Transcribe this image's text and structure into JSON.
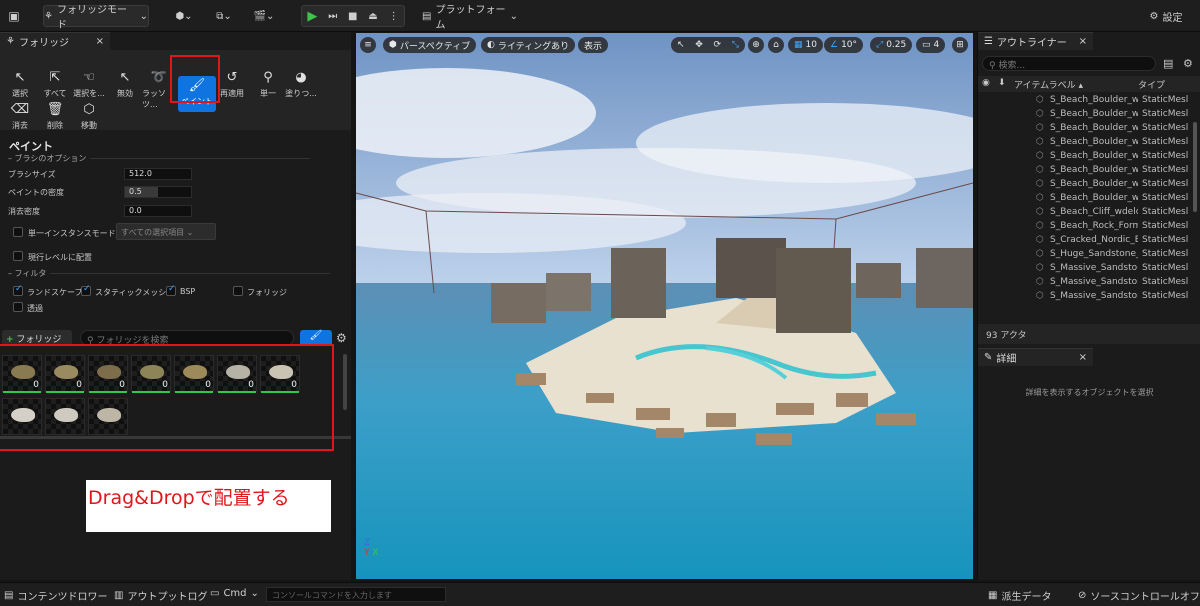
{
  "toolbar": {
    "mode_label": "フォリッジモード",
    "platform_label": "プラットフォーム",
    "settings_label": "設定"
  },
  "foliage_tab": {
    "title": "フォリッジ"
  },
  "tools": [
    {
      "label": "選択",
      "icon": "cursor-icon"
    },
    {
      "label": "すべて",
      "icon": "select-all-icon"
    },
    {
      "label": "選択を...",
      "icon": "hand-icon"
    },
    {
      "label": "無効",
      "icon": "invalid-icon"
    },
    {
      "label": "ラッソツ...",
      "icon": "lasso-icon"
    },
    {
      "label": "ペイント",
      "icon": "paintbrush-icon"
    },
    {
      "label": "再適用",
      "icon": "reapply-icon"
    },
    {
      "label": "単一",
      "icon": "single-icon"
    },
    {
      "label": "塗りつ...",
      "icon": "fill-icon"
    },
    {
      "label": "消去",
      "icon": "erase-icon"
    },
    {
      "label": "削除",
      "icon": "trash-icon"
    },
    {
      "label": "移動",
      "icon": "move-icon"
    }
  ],
  "paint": {
    "title": "ペイント",
    "brush_section": "ブラシのオプション",
    "brush_size_label": "ブラシサイズ",
    "brush_size_value": "512.0",
    "paint_density_label": "ペイントの密度",
    "paint_density_value": "0.5",
    "erase_density_label": "消去密度",
    "erase_density_value": "0.0",
    "single_instance_label": "単一インスタンスモード:",
    "single_instance_value": "すべての選択項目",
    "current_level_label": "現行レベルに配置",
    "filter_section": "フィルタ",
    "filters": [
      {
        "label": "ランドスケープ",
        "checked": true
      },
      {
        "label": "スタティックメッシュ",
        "checked": true
      },
      {
        "label": "BSP",
        "checked": true
      },
      {
        "label": "フォリッジ",
        "checked": false
      },
      {
        "label": "透過",
        "checked": false
      }
    ]
  },
  "foliage_list": {
    "add_button": "フォリッジ",
    "search_placeholder": "フォリッジを検索",
    "items": [
      {
        "count": "0",
        "color": "#8a7a52"
      },
      {
        "count": "0",
        "color": "#9a8a60"
      },
      {
        "count": "0",
        "color": "#7d6d4a"
      },
      {
        "count": "0",
        "color": "#8d8458"
      },
      {
        "count": "0",
        "color": "#9c8a5a"
      },
      {
        "count": "0",
        "color": "#b7b2a6"
      },
      {
        "count": "0",
        "color": "#c9c3b4"
      },
      {
        "count": "",
        "color": "#d4d0c8"
      },
      {
        "count": "",
        "color": "#cfcac0"
      },
      {
        "count": "",
        "color": "#bdb5a5"
      }
    ]
  },
  "annotation": {
    "text": "Drag&Dropで配置する"
  },
  "viewport": {
    "perspective": "パースペクティブ",
    "lighting": "ライティングあり",
    "show": "表示",
    "grid_snap": "10",
    "angle_snap": "10°",
    "scale_snap": "0.25",
    "camera_speed": "4"
  },
  "outliner": {
    "title": "アウトライナー",
    "search_placeholder": "検索...",
    "col_label": "アイテムラベル",
    "col_type": "タイプ",
    "rows": [
      {
        "label": "S_Beach_Boulder_wc",
        "type": "StaticMesl"
      },
      {
        "label": "S_Beach_Boulder_wc",
        "type": "StaticMesl"
      },
      {
        "label": "S_Beach_Boulder_wc",
        "type": "StaticMesl"
      },
      {
        "label": "S_Beach_Boulder_we",
        "type": "StaticMesl"
      },
      {
        "label": "S_Beach_Boulder_we",
        "type": "StaticMesl"
      },
      {
        "label": "S_Beach_Boulder_we",
        "type": "StaticMesl"
      },
      {
        "label": "S_Beach_Boulder_we",
        "type": "StaticMesl"
      },
      {
        "label": "S_Beach_Boulder_wf",
        "type": "StaticMesl"
      },
      {
        "label": "S_Beach_Cliff_wdelc",
        "type": "StaticMesl"
      },
      {
        "label": "S_Beach_Rock_Form",
        "type": "StaticMesl"
      },
      {
        "label": "S_Cracked_Nordic_B",
        "type": "StaticMesl"
      },
      {
        "label": "S_Huge_Sandstone_(",
        "type": "StaticMesl"
      },
      {
        "label": "S_Massive_Sandstor",
        "type": "StaticMesl"
      },
      {
        "label": "S_Massive_Sandstor",
        "type": "StaticMesl"
      },
      {
        "label": "S_Massive_Sandstor",
        "type": "StaticMesl"
      }
    ],
    "actor_count": "93 アクタ"
  },
  "details": {
    "title": "詳細",
    "empty_message": "詳細を表示するオブジェクトを選択"
  },
  "bottom": {
    "content_drawer": "コンテンツドロワー",
    "output_log": "アウトプットログ",
    "cmd": "Cmd",
    "console_placeholder": "コンソールコマンドを入力します",
    "derived_data": "派生データ",
    "source_control": "ソースコントロールオフ"
  }
}
